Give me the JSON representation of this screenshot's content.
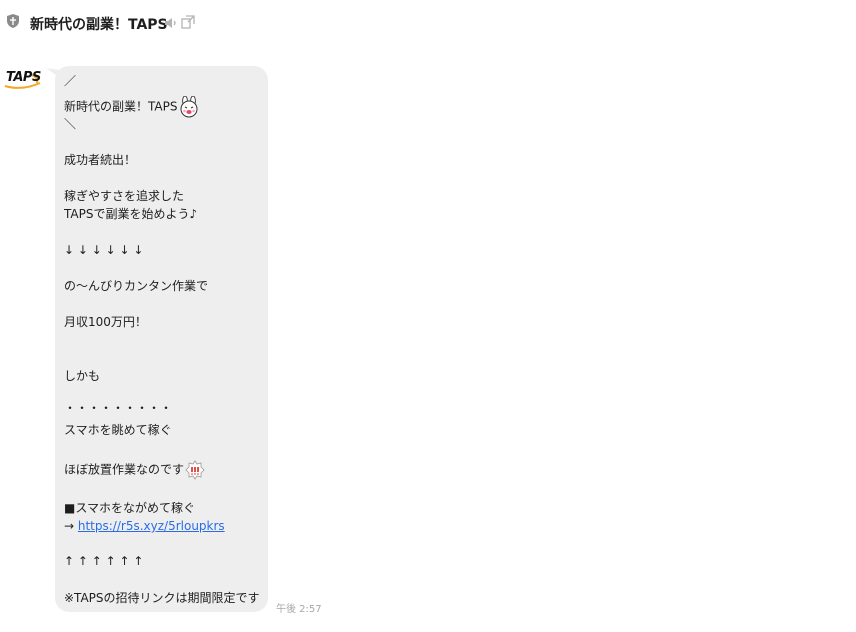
{
  "header": {
    "title": "新時代の副業！TAPS"
  },
  "avatar": {
    "logo_text": "TAPS"
  },
  "message": {
    "lines": [
      "／",
      "新時代の副業！TAPS",
      "＼",
      "成功者続出！",
      "稼ぎやすさを追求した",
      "TAPSで副業を始めよう♪",
      "↓ ↓ ↓ ↓ ↓ ↓",
      "の〜んびりカンタン作業で",
      "月収100万円！",
      "しかも",
      "・・・・・・・・・",
      "スマホを眺めて稼ぐ",
      "ほぼ放置作業なのです",
      "■スマホをながめて稼ぐ",
      "→ ",
      "↑ ↑ ↑ ↑ ↑ ↑",
      "※TAPSの招待リンクは期間限定です"
    ],
    "link_text": "https://r5s.xyz/5rloupkrs",
    "timestamp": "午後 2:57",
    "emojis": {
      "bunny": "bunny-face-emoji",
      "alert": "exclamation-badge-emoji"
    }
  },
  "colors": {
    "bubble_bg": "#eeeeee",
    "link": "#2a6ce8",
    "timestamp": "#a8a8a8",
    "logo_accent": "#f5a623"
  }
}
